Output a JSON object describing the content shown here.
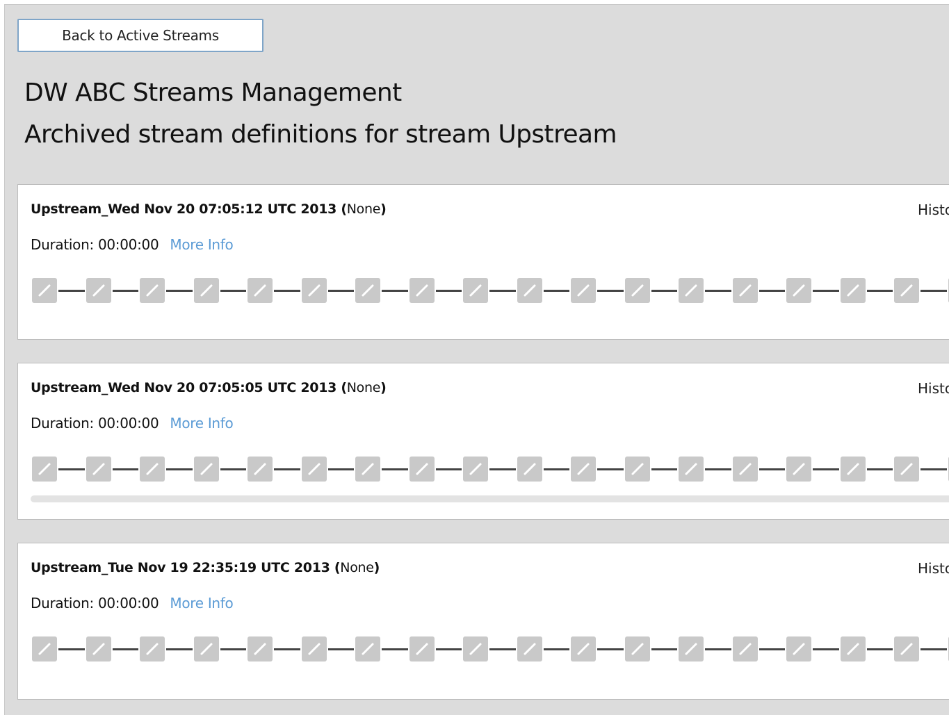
{
  "nav": {
    "back_label": "Back to Active Streams"
  },
  "page": {
    "title": "DW ABC Streams Management",
    "subtitle": "Archived stream definitions for stream Upstream"
  },
  "streams": [
    {
      "name": "Upstream_Wed Nov 20 07:05:12 UTC 2013",
      "status": "None",
      "duration_label": "Duration: 00:00:00",
      "more_info": "More Info",
      "history_label": "Histo",
      "has_scrollbar": false
    },
    {
      "name": "Upstream_Wed Nov 20 07:05:05 UTC 2013",
      "status": "None",
      "duration_label": "Duration: 00:00:00",
      "more_info": "More Info",
      "history_label": "Histo",
      "has_scrollbar": true
    },
    {
      "name": "Upstream_Tue Nov 19 22:35:19 UTC 2013",
      "status": "None",
      "duration_label": "Duration: 00:00:00",
      "more_info": "More Info",
      "history_label": "Histo",
      "has_scrollbar": false
    }
  ],
  "step_icon": "edit-pencil-icon",
  "colors": {
    "accent_link": "#5b9bd5",
    "step_gray": "#c9c9c9",
    "panel_bg": "#dcdcdc"
  }
}
